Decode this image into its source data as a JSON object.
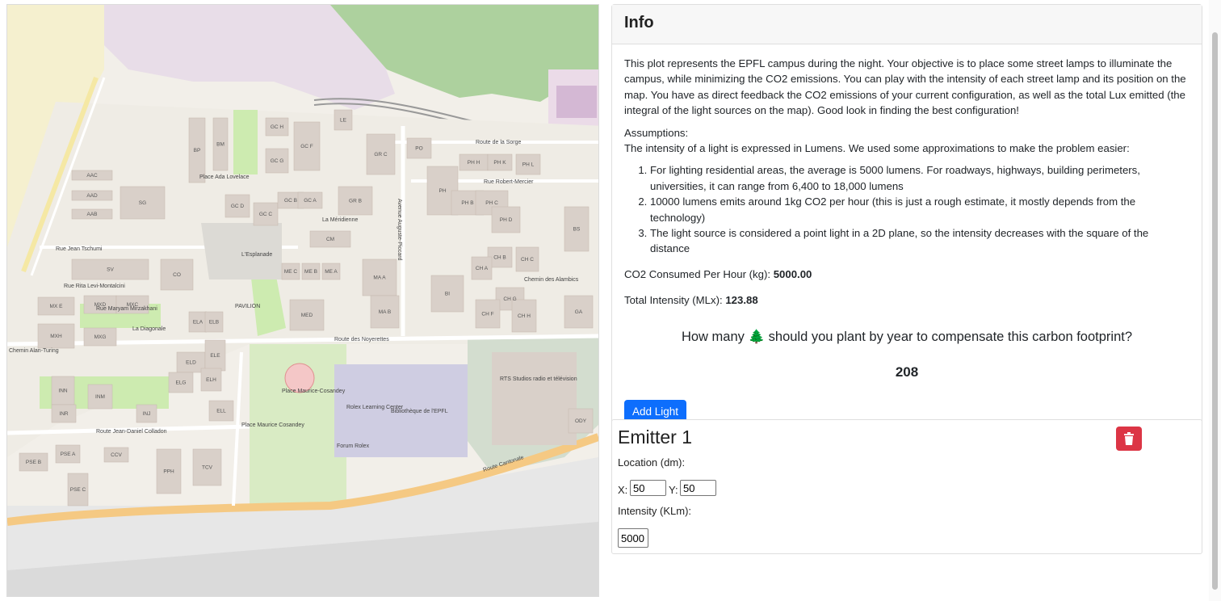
{
  "map": {
    "street_labels": {
      "route_sorge": "Route de la Sorge",
      "route_robert_mercier": "Rue Robert-Mercier",
      "meridienne": "La Méridienne",
      "esplanade": "L'Esplanade",
      "rue_jean_tschumi": "Rue Jean Tschumi",
      "rue_rita": "Rue Rita Levi-Montalcini",
      "rue_maryam": "Rue Maryam Mirzakhani",
      "ladiagonale": "La Diagonale",
      "chemin_alan": "Chemin Alan-Turing",
      "route_noyerettes": "Route des Noyerettes",
      "place_cosandey": "Place Maurice Cosandey",
      "route_cantonale": "Route Cantonale",
      "rue_colladon": "Route Jean-Daniel Colladon",
      "chemin_alambics": "Chemin des Alambics",
      "place_ada": "Place Ada Lovelace",
      "place_maurice": "Place Maurice-Cosandey",
      "rolex": "Rolex Learning Center",
      "bibliotheque": "Bibliothèque de l'EPFL",
      "pavilion": "PAVILION",
      "rts": "RTS Studios radio et télévision",
      "forum": "Forum Rolex",
      "avenue_piccard": "Avenue Auguste-Piccard"
    },
    "buildings": [
      "CO",
      "SG",
      "AAC",
      "AAD",
      "AAB",
      "GC H",
      "GC G",
      "GC F",
      "GC D",
      "GC C",
      "GC B",
      "GC A",
      "GR B",
      "GR C",
      "PO",
      "PH",
      "PH B",
      "PH C",
      "PH D",
      "PH H",
      "PH K",
      "PH L",
      "CH B",
      "CH C",
      "CH A",
      "CH G",
      "CH F",
      "CH H",
      "GA",
      "MX E",
      "MXD",
      "MXC",
      "MXG",
      "MXH",
      "ELA",
      "ELB",
      "ELD",
      "ELE",
      "ELG",
      "ELH",
      "ELL",
      "INN",
      "INM",
      "INR",
      "INJ",
      "SV",
      "ME C",
      "ME B",
      "ME A",
      "MA A",
      "MA B",
      "MED",
      "BI",
      "BS",
      "CM",
      "PSE B",
      "PSE A",
      "PSE C",
      "CCV",
      "PPH",
      "TCV",
      "ODY",
      "BP",
      "BM",
      "LE"
    ]
  },
  "info": {
    "title": "Info",
    "description": "This plot represents the EPFL campus during the night. Your objective is to place some street lamps to illuminate the campus, while minimizing the CO2 emissions. You can play with the intensity of each street lamp and its position on the map. You have as direct feedback the CO2 emissions of your current configuration, as well as the total Lux emitted (the integral of the light sources on the map). Good look in finding the best configuration!",
    "assumptions_title": "Assumptions:",
    "assumptions_intro": "The intensity of a light is expressed in Lumens. We used some approximations to make the problem easier:",
    "assumptions": [
      "For lighting residential areas, the average is 5000 lumens. For roadways, highways, building perimeters, universities, it can range from 6,400 to 18,000 lumens",
      "10000 lumens emits around 1kg CO2 per hour (this is just a rough estimate, it mostly depends from the technology)",
      "The light source is considered a point light in a 2D plane, so the intensity decreases with the square of the distance"
    ],
    "co2_label": "CO2 Consumed Per Hour (kg):",
    "co2_value": "5000.00",
    "intensity_label": "Total Intensity (MLx):",
    "intensity_value": "123.88",
    "question_pre": "How many",
    "question_icon": "🌲",
    "question_post": "should you plant by year to compensate this carbon footprint?",
    "answer": "208",
    "add_button": "Add Light"
  },
  "emitter": {
    "title": "Emitter 1",
    "location_label": "Location (dm):",
    "x_label": "X:",
    "x_value": "50",
    "y_label": "Y:",
    "y_value": "50",
    "intensity_label": "Intensity (KLm):",
    "intensity_value": "5000"
  },
  "colors": {
    "primary": "#0d6efd",
    "danger": "#dc3545",
    "building": "#d9d0c9",
    "road_main": "#f5c983",
    "green": "#cdebb0",
    "rail_zone": "#e6dbe6"
  }
}
